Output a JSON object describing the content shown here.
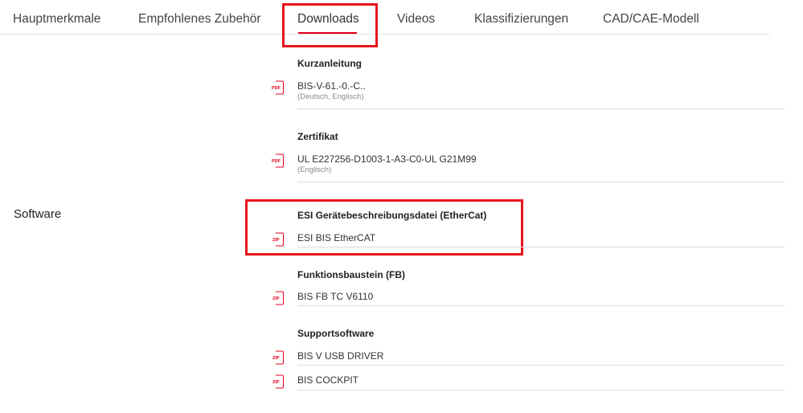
{
  "tabs": [
    {
      "label": "Hauptmerkmale"
    },
    {
      "label": "Empfohlenes Zubehör"
    },
    {
      "label": "Downloads"
    },
    {
      "label": "Videos"
    },
    {
      "label": "Klassifizierungen"
    },
    {
      "label": "CAD/CAE-Modell"
    }
  ],
  "active_tab": "Downloads",
  "software_label": "Software",
  "sections": [
    {
      "title": "Kurzanleitung",
      "files": [
        {
          "type": "PDF",
          "name": "BIS-V-61.-0.-C..",
          "language": "(Deutsch, Englisch)"
        }
      ]
    },
    {
      "title": "Zertifikat",
      "files": [
        {
          "type": "PDF",
          "name": "UL E227256-D1003-1-A3-C0-UL G21M99",
          "language": "(Englisch)"
        }
      ]
    },
    {
      "title": "ESI Gerätebeschreibungsdatei (EtherCat)",
      "files": [
        {
          "type": "ZIP",
          "name": "ESI BIS EtherCAT"
        }
      ]
    },
    {
      "title": "Funktionsbaustein (FB)",
      "files": [
        {
          "type": "ZIP",
          "name": "BIS FB TC V6110"
        }
      ]
    },
    {
      "title": "Supportsoftware",
      "files": [
        {
          "type": "ZIP",
          "name": "BIS V USB DRIVER"
        },
        {
          "type": "ZIP",
          "name": "BIS COCKPIT"
        }
      ]
    }
  ],
  "colors": {
    "accent": "#e2001a",
    "highlight": "#e8141d",
    "divider": "#dcdcdc"
  },
  "icons": {
    "pdf": "pdf-file-icon",
    "zip": "zip-file-icon"
  }
}
